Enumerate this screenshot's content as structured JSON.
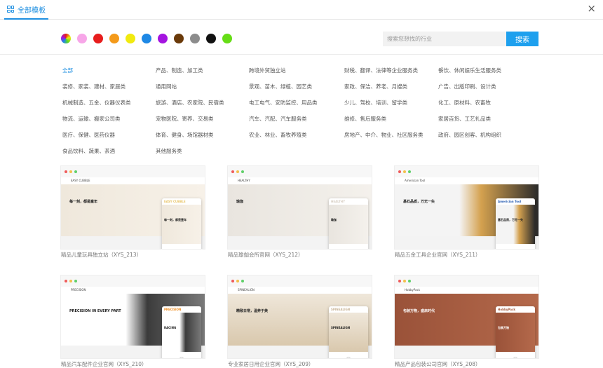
{
  "header": {
    "tab_label": "全部模板",
    "close_icon": "×"
  },
  "colors": [
    "conic",
    "#f7a6e8",
    "#e71d1d",
    "#f49a1a",
    "#f1ea0f",
    "#1e88e5",
    "#a414e0",
    "#6a3a0a",
    "#8c8c8c",
    "#111111",
    "#66dd16"
  ],
  "search": {
    "placeholder": "搜索您想找的行业",
    "button_label": "搜索"
  },
  "categories": [
    "全部",
    "产品、制造、加工类",
    "跨境外贸独立站",
    "财税、翻译、法律等企业服务类",
    "餐饮、休闲娱乐生活服务类",
    "装修、家装、建材、家居类",
    "通用网站",
    "景观、苗木、绿植、园艺类",
    "家政、保洁、养老、月嫂类",
    "广告、出版印刷、设计类",
    "机械制造、五金、仪器仪表类",
    "旅游、酒店、农家院、民宿类",
    "电工电气、安防监控、用品类",
    "少儿、驾校、培训、留学类",
    "化工、原材料、农畜牧",
    "物流、运输、搬家公司类",
    "宠物医院、寄养、交易类",
    "汽车、汽配、汽车服务类",
    "维修、售后服务类",
    "家居百货、工艺礼品类",
    "医疗、保健、医药仪器",
    "体育、健身、场馆器材类",
    "农业、林业、畜牧养殖类",
    "房地产、中介、物业、社区服务类",
    "政府、园区创客、机构组织",
    "食品饮料、蔬果、茶酒",
    "其他服务类"
  ],
  "templates": [
    {
      "caption": "精品儿童玩具独立站（XYS_213）",
      "brand": "EASY CUBBLE",
      "hero_text": "每一刻，都是童年",
      "phone_text": "每一刻，都是童年",
      "accent": "#e8c56a"
    },
    {
      "caption": "精品瑜伽会所官网（XYS_212）",
      "brand": "HEALTHY",
      "hero_text": "瑜伽",
      "phone_text": "瑜伽",
      "accent": "#d8cfc4"
    },
    {
      "caption": "精品五金工具企业官网（XYS_211）",
      "brand": "Americian Tool",
      "hero_text": "基石品质，万无一失",
      "phone_text": "基石品质，万无一失",
      "accent": "#2b5fb3"
    },
    {
      "caption": "精品汽车配件企业官网（XYS_210）",
      "brand": "PRECISION",
      "hero_text": "PRECISION IN EVERY PART",
      "phone_text": "RACING",
      "accent": "#ef8c1e"
    },
    {
      "caption": "专业家居日用企业官网（XYS_209）",
      "brand": "SPINEALIGN",
      "hero_text": "精致日常，温养于美",
      "phone_text": "SPINEALIGN",
      "accent": "#c9b497"
    },
    {
      "caption": "精品产品包装公司官网（XYS_208）",
      "brand": "HobbyPack",
      "hero_text": "包装万物，盛启时代",
      "phone_text": "包装万物",
      "accent": "#a85f43"
    }
  ]
}
